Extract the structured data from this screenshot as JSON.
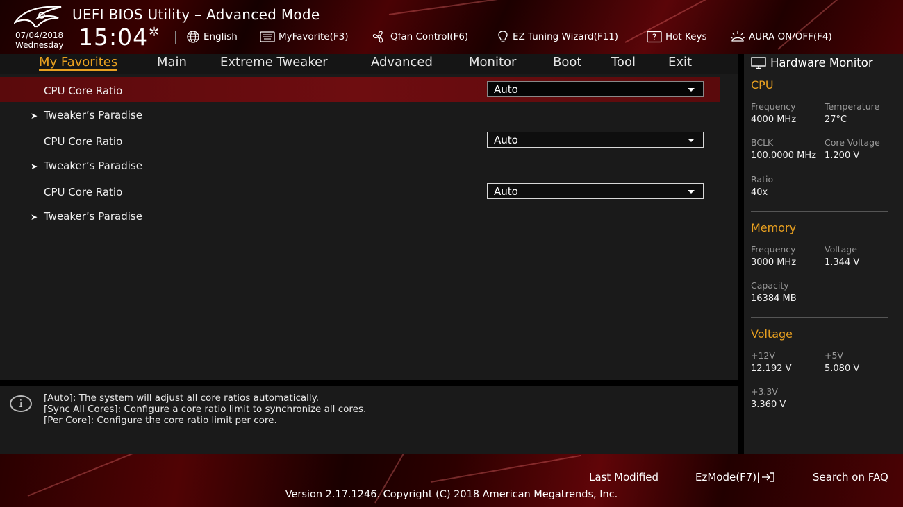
{
  "app": {
    "title": "UEFI BIOS Utility – Advanced Mode",
    "date": "07/04/2018",
    "weekday": "Wednesday",
    "time": "15:04"
  },
  "toolbar": {
    "language": "English",
    "favorite": "MyFavorite(F3)",
    "qfan": "Qfan Control(F6)",
    "ez_tuning": "EZ Tuning Wizard(F11)",
    "hotkeys": "Hot Keys",
    "aura": "AURA ON/OFF(F4)"
  },
  "tabs": [
    {
      "label": "My Favorites",
      "active": true
    },
    {
      "label": "Main"
    },
    {
      "label": "Extreme Tweaker"
    },
    {
      "label": "Advanced"
    },
    {
      "label": "Monitor"
    },
    {
      "label": "Boot"
    },
    {
      "label": "Tool"
    },
    {
      "label": "Exit"
    }
  ],
  "items": {
    "r1": {
      "label": "CPU Core Ratio",
      "value": "Auto"
    },
    "s1": {
      "label": "Tweaker’s Paradise"
    },
    "r2": {
      "label": "CPU Core Ratio",
      "value": "Auto"
    },
    "s2": {
      "label": "Tweaker’s Paradise"
    },
    "r3": {
      "label": "CPU Core Ratio",
      "value": "Auto"
    },
    "s3": {
      "label": "Tweaker’s Paradise"
    }
  },
  "help": {
    "line1": "[Auto]: The system will adjust all core ratios automatically.",
    "line2": "[Sync All Cores]: Configure a core ratio limit to synchronize all cores.",
    "line3": "[Per Core]: Configure the core ratio limit per core."
  },
  "hardware_monitor": {
    "title": "Hardware Monitor",
    "cpu": {
      "heading": "CPU",
      "frequency_label": "Frequency",
      "frequency": "4000 MHz",
      "temperature_label": "Temperature",
      "temperature": "27°C",
      "bclk_label": "BCLK",
      "bclk": "100.0000 MHz",
      "core_voltage_label": "Core Voltage",
      "core_voltage": "1.200 V",
      "ratio_label": "Ratio",
      "ratio": "40x"
    },
    "memory": {
      "heading": "Memory",
      "frequency_label": "Frequency",
      "frequency": "3000 MHz",
      "voltage_label": "Voltage",
      "voltage": "1.344 V",
      "capacity_label": "Capacity",
      "capacity": "16384 MB"
    },
    "voltage": {
      "heading": "Voltage",
      "v12_label": "+12V",
      "v12": "12.192 V",
      "v5_label": "+5V",
      "v5": "5.080 V",
      "v33_label": "+3.3V",
      "v33": "3.360 V"
    }
  },
  "footer": {
    "last_modified": "Last Modified",
    "ezmode": "EzMode(F7)|",
    "search_faq": "Search on FAQ",
    "copyright": "Version 2.17.1246. Copyright (C) 2018 American Megatrends, Inc."
  },
  "colors": {
    "accent": "#e8a020",
    "selected_row": "#6e0d10",
    "panel_bg": "#1a1a1a"
  },
  "icons": [
    "rog-logo",
    "gear-icon",
    "globe-icon",
    "keyboard-icon",
    "fan-icon",
    "bulb-icon",
    "help-key-icon",
    "aura-icon",
    "monitor-icon",
    "info-icon",
    "exit-arrow-icon"
  ]
}
